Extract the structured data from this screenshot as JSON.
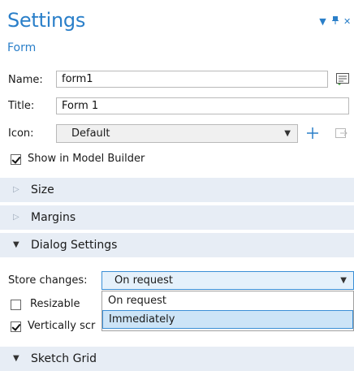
{
  "header": {
    "title": "Settings",
    "subtitle": "Form"
  },
  "header_icons": [
    "chevron-down-icon",
    "pin-icon",
    "close-icon"
  ],
  "form": {
    "name_label": "Name:",
    "name_value": "form1",
    "title_label": "Title:",
    "title_value": "Form 1",
    "icon_label": "Icon:",
    "icon_value": "Default",
    "show_in_model_builder_label": "Show in Model Builder",
    "show_in_model_builder_checked": true
  },
  "sections": {
    "size": "Size",
    "margins": "Margins",
    "dialog_settings": "Dialog Settings",
    "sketch_grid": "Sketch Grid"
  },
  "dialog_settings": {
    "store_changes_label": "Store changes:",
    "store_changes_value": "On request",
    "options": [
      "On request",
      "Immediately"
    ],
    "highlighted_option": "Immediately",
    "resizable_label": "Resizable",
    "resizable_checked": false,
    "vertically_scroll_label": "Vertically scr",
    "vertically_scroll_checked": true
  },
  "colors": {
    "accent": "#2a7fc9",
    "section_bg": "#e7edf5",
    "highlight": "#cce4f7"
  }
}
